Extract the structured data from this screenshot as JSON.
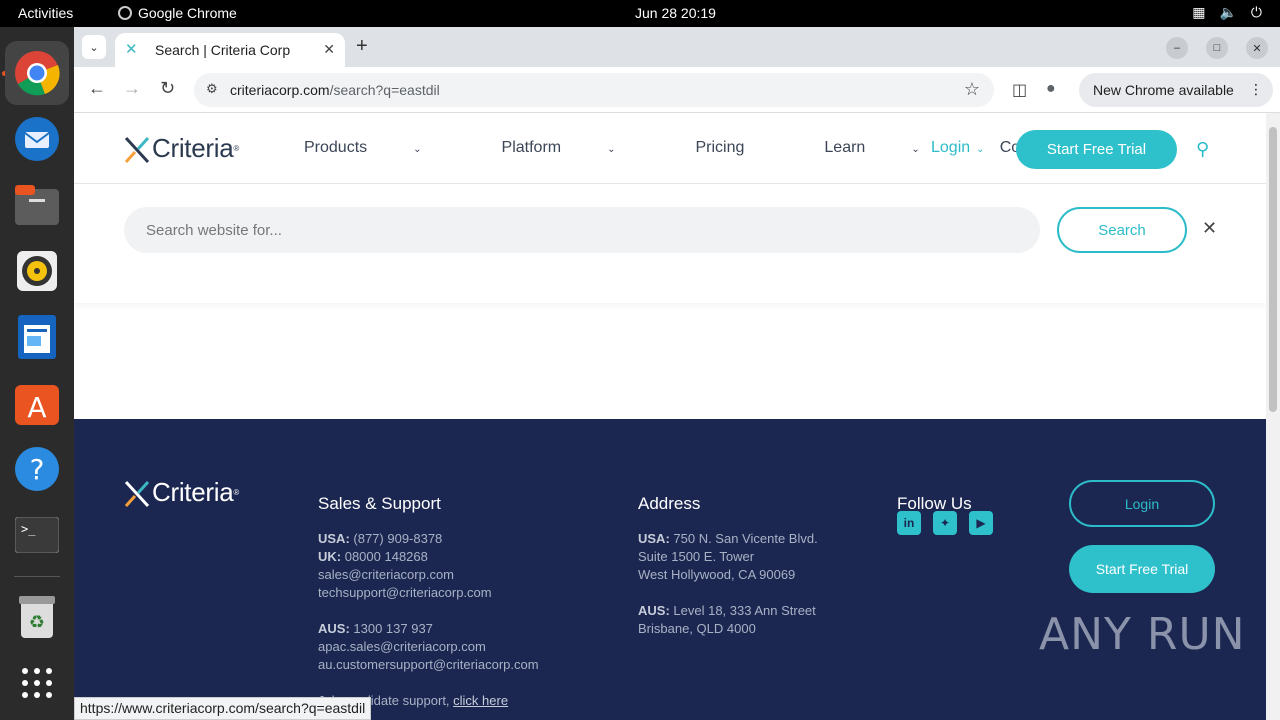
{
  "topbar": {
    "activities": "Activities",
    "app_name": "Google Chrome",
    "clock": "Jun 28  20:19"
  },
  "dock": {
    "items": [
      "chrome-icon",
      "thunderbird-icon",
      "files-icon",
      "rhythmbox-icon",
      "writer-icon",
      "appcenter-icon",
      "help-icon",
      "terminal-icon",
      "trash-icon",
      "apps-grid-icon"
    ]
  },
  "browser": {
    "tab_title": "Search | Criteria Corp",
    "url_domain": "criteriacorp.com",
    "url_path": "/search?q=eastdil",
    "update_label": "New Chrome available",
    "status_url": "https://www.criteriacorp.com/search?q=eastdil"
  },
  "site": {
    "logo_text": "Criteria",
    "nav": [
      {
        "label": "Products"
      },
      {
        "label": "Platform"
      },
      {
        "label": "Pricing"
      },
      {
        "label": "Learn"
      },
      {
        "label": "Company"
      }
    ],
    "login": "Login",
    "trial": "Start Free Trial",
    "search_placeholder": "Search website for...",
    "search_button": "Search"
  },
  "footer": {
    "sales_title": "Sales & Support",
    "usa_label": "USA:",
    "usa_phone": " (877) 909-8378",
    "uk_label": "UK:",
    "uk_phone": " 08000 148268",
    "sales_email": "sales@criteriacorp.com",
    "tech_email": "techsupport@criteriacorp.com",
    "aus_label": "AUS:",
    "aus_phone": " 1300 137 937",
    "apac_email": "apac.sales@criteriacorp.com",
    "au_email": "au.customersupport@criteriacorp.com",
    "job_text": "Job candidate support, ",
    "job_link": "click here",
    "address_title": "Address",
    "addr_usa_label": "USA:",
    "addr_usa_1": " 750 N. San Vicente Blvd.",
    "addr_usa_2": "Suite 1500 E. Tower",
    "addr_usa_3": "West Hollywood, CA 90069",
    "addr_aus_label": "AUS:",
    "addr_aus_1": " Level 18, 333 Ann Street",
    "addr_aus_2": "Brisbane, QLD 4000",
    "follow_title": "Follow Us",
    "login_button": "Login",
    "trial_button": "Start Free Trial",
    "watermark": "ANY RUN"
  },
  "colors": {
    "accent": "#2ec0cb",
    "footer_bg": "#1b2750",
    "logo_orange": "#f5a03a"
  }
}
